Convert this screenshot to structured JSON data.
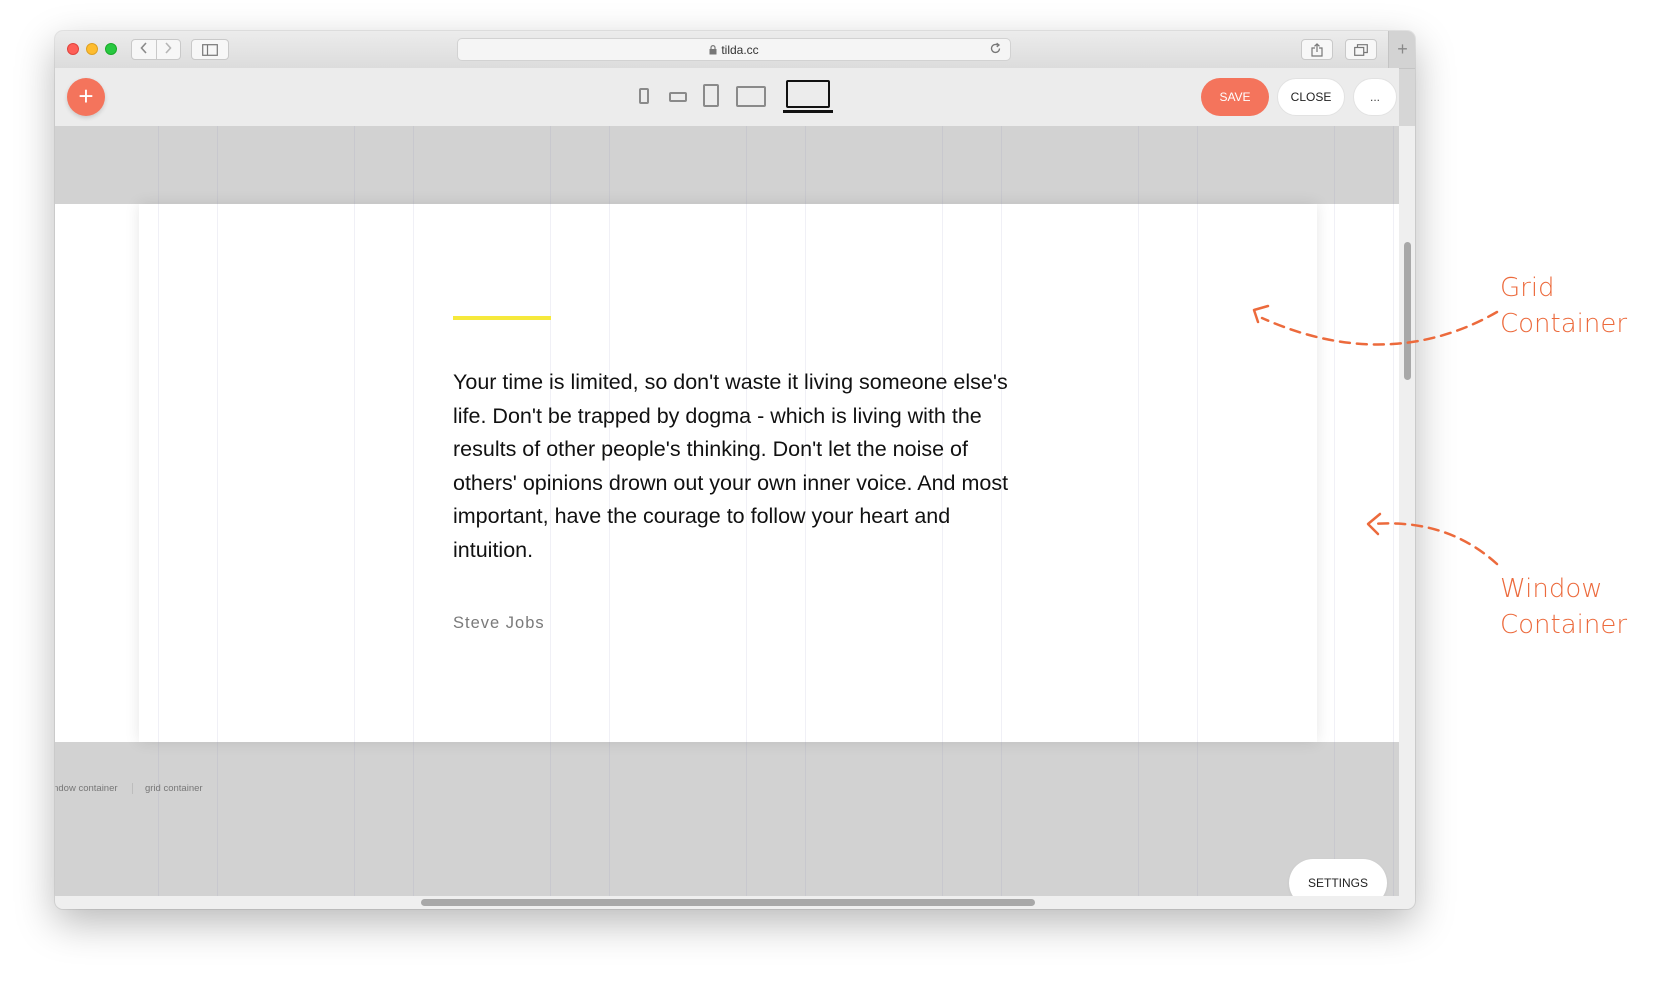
{
  "browser": {
    "url": "tilda.cc",
    "new_tab_symbol": "+",
    "icons": {
      "lock": "lock-icon",
      "reload": "reload-icon",
      "back": "chevron-left-icon",
      "forward": "chevron-right-icon",
      "sidebar": "sidebar-icon",
      "share": "share-icon",
      "tabs": "tabs-icon"
    }
  },
  "toolbar": {
    "add_symbol": "+",
    "save_label": "SAVE",
    "close_label": "CLOSE",
    "more_label": "...",
    "devices": [
      "mobile",
      "mobile-landscape",
      "tablet",
      "tablet-landscape",
      "desktop"
    ],
    "active_device": "desktop"
  },
  "content": {
    "quote": "Your time is limited, so don't waste it living someone else's life. Don't be trapped by dogma - which is living with the results of other people's thinking. Don't let the noise of others' opinions drown out your own inner voice. And most important, have the courage to follow your heart and intuition.",
    "author": "Steve Jobs",
    "accent_color": "#f6e93b"
  },
  "canvas_labels": {
    "window_container": "indow container",
    "grid_container": "grid container"
  },
  "settings_label": "SETTINGS",
  "annotations": {
    "grid_container": "Grid Container",
    "window_container_line1": "Window",
    "window_container_line2": "Container",
    "color": "#ec6a3c"
  },
  "colors": {
    "brand": "#f4745c",
    "canvas_bg": "#d2d2d2"
  }
}
